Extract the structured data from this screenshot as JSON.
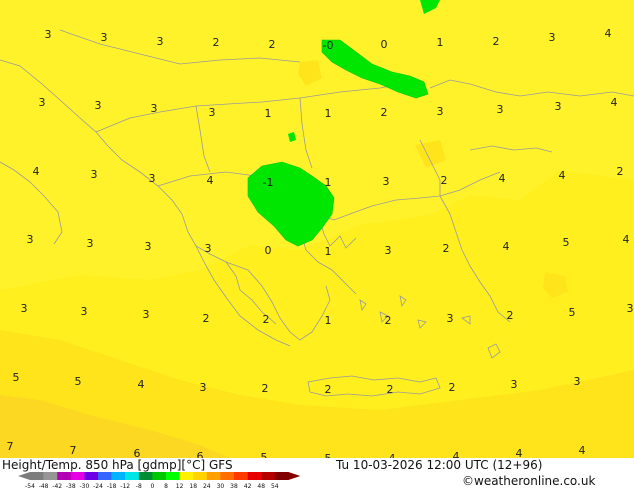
{
  "map": {
    "colors": {
      "sea_yellow": "#ffef1f",
      "light_yellow": "#fff22a",
      "amber_zone": "#ffe41c",
      "orange_zone": "#fcd823",
      "green_zero": "#00e600",
      "green_zero_edge": "#00c800",
      "coastline": "#9a9a9a"
    },
    "labels": [
      "3",
      "3",
      "3",
      "2",
      "2",
      "-0",
      "0",
      "1",
      "2",
      "3",
      "4",
      "3",
      "3",
      "3",
      "3",
      "1",
      "1",
      "2",
      "3",
      "3",
      "3",
      "4",
      "4",
      "3",
      "3",
      "4",
      "-1",
      "1",
      "3",
      "2",
      "4",
      "4",
      "2",
      "3",
      "3",
      "3",
      "3",
      "0",
      "1",
      "3",
      "2",
      "4",
      "5",
      "4",
      "3",
      "3",
      "3",
      "2",
      "2",
      "1",
      "2",
      "3",
      "2",
      "5",
      "3",
      "5",
      "5",
      "4",
      "3",
      "2",
      "2",
      "2",
      "2",
      "3",
      "3",
      "7",
      "7",
      "6",
      "6",
      "5",
      "5",
      "4",
      "4",
      "4",
      "4"
    ]
  },
  "footer": {
    "title": "Height/Temp. 850 hPa [gdmp][°C] GFS",
    "datetime": "Tu 10-03-2026 12:00 UTC (12+96)",
    "credit": "©weatheronline.co.uk",
    "colorbar_ticks": [
      "-54",
      "-48",
      "-42",
      "-38",
      "-30",
      "-24",
      "-18",
      "-12",
      "-8",
      "0",
      "8",
      "12",
      "18",
      "24",
      "30",
      "38",
      "42",
      "48",
      "54"
    ],
    "colorbar_colors": [
      "#7c7c7c",
      "#969696",
      "#b400b4",
      "#e600e6",
      "#6e00e6",
      "#3264ff",
      "#00b4ff",
      "#00e6e6",
      "#008c32",
      "#00c800",
      "#00ff00",
      "#fff000",
      "#ffd200",
      "#ffa000",
      "#ff6e00",
      "#ff3c00",
      "#e60000",
      "#b40000",
      "#820000"
    ]
  }
}
